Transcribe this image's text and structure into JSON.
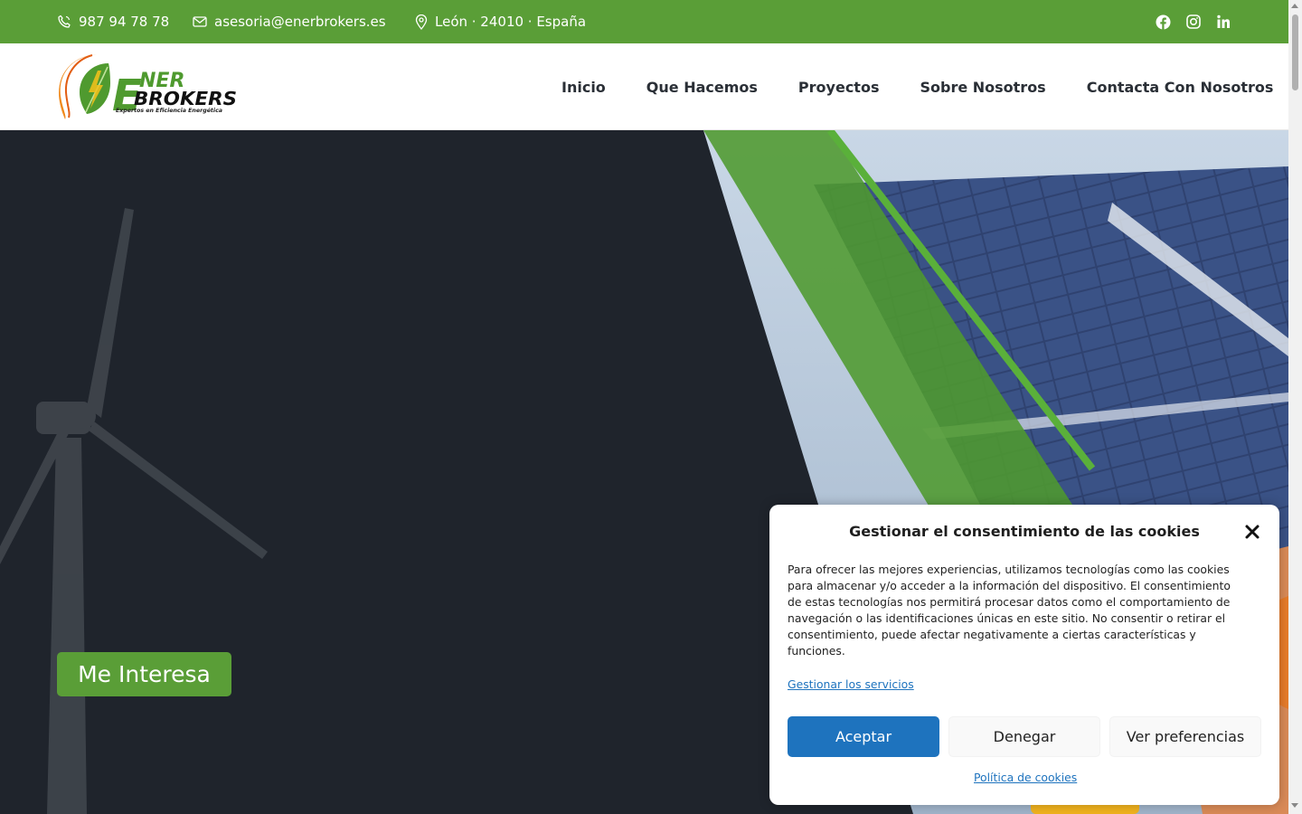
{
  "topbar": {
    "phone": "987 94 78 78",
    "email": "asesoria@enerbrokers.es",
    "location": "León · 24010 · España",
    "social": [
      "facebook-icon",
      "instagram-icon",
      "linkedin-icon"
    ],
    "bg_color": "#5a9e37"
  },
  "header": {
    "logo": {
      "line1": "NER",
      "line2": "BROKERS",
      "initial": "E",
      "tagline": "Expertos en Eficiencia Energética"
    },
    "nav": [
      "Inicio",
      "Que Hacemos",
      "Proyectos",
      "Sobre Nosotros",
      "Contacta Con Nosotros"
    ]
  },
  "hero": {
    "cta_label": "Me Interesa"
  },
  "cookie": {
    "title": "Gestionar el consentimiento de las cookies",
    "body": "Para ofrecer las mejores experiencias, utilizamos tecnologías como las cookies para almacenar y/o acceder a la información del dispositivo. El consentimiento de estas tecnologías nos permitirá procesar datos como el comportamiento de navegación o las identificaciones únicas en este sitio. No consentir o retirar el consentimiento, puede afectar negativamente a ciertas características y funciones.",
    "manage_link": "Gestionar los servicios",
    "accept": "Aceptar",
    "deny": "Denegar",
    "prefs": "Ver preferencias",
    "policy_link": "Política de cookies",
    "accent_color": "#1e73be"
  }
}
